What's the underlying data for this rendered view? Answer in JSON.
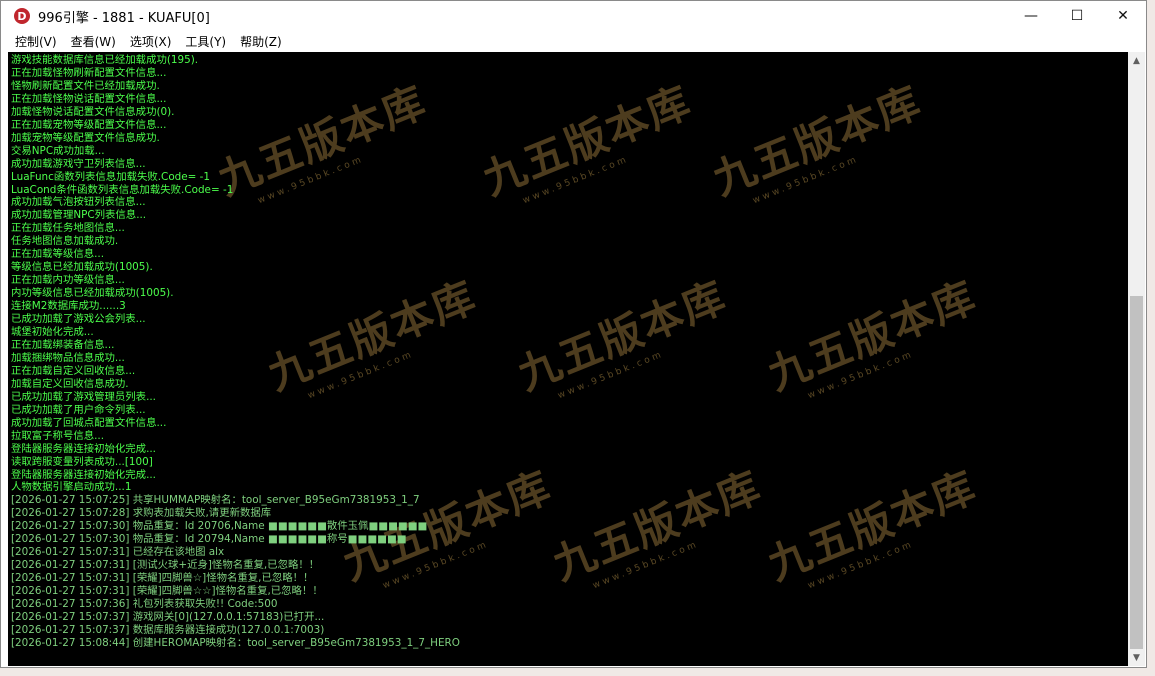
{
  "window": {
    "title": "996引擎 - 1881 - KUAFU[0]",
    "icon_letter": "D",
    "controls": {
      "minimize": "—",
      "maximize": "☐",
      "close": "✕"
    }
  },
  "menu": [
    "控制(V)",
    "查看(W)",
    "选项(X)",
    "工具(Y)",
    "帮助(Z)"
  ],
  "watermark": {
    "text": "九五版本库",
    "sub": "www.95bbk.com"
  },
  "log": [
    "游戏技能数据库信息已经加载成功(195).",
    "正在加载怪物刷新配置文件信息...",
    "怪物刷新配置文件已经加载成功.",
    "正在加载怪物说话配置文件信息...",
    "加载怪物说话配置文件信息成功(0).",
    "正在加载宠物等级配置文件信息...",
    "加载宠物等级配置文件信息成功.",
    "交易NPC成功加载...",
    "成功加载游戏守卫列表信息...",
    "LuaFunc函数列表信息加载失败.Code= -1",
    "LuaCond条件函数列表信息加载失败.Code= -1",
    "成功加载气泡按钮列表信息...",
    "成功加载管理NPC列表信息...",
    "正在加载任务地图信息...",
    "任务地图信息加载成功.",
    "正在加载等级信息...",
    "等级信息已经加载成功(1005).",
    "正在加载内功等级信息...",
    "内功等级信息已经加载成功(1005).",
    "连接M2数据库成功......3",
    "已成功加载了游戏公会列表...",
    "城堡初始化完成...",
    "正在加载绑装备信息...",
    "加载捆绑物品信息成功...",
    "正在加载自定义回收信息...",
    "加载自定义回收信息成功.",
    "已成功加载了游戏管理员列表...",
    "已成功加载了用户命令列表...",
    "成功加载了回城点配置文件信息...",
    "拉取富子称号信息...",
    "登陆器服务器连接初始化完成...",
    "读取跨服变量列表成功...[100]",
    "登陆器服务器连接初始化完成...",
    "人物数据引擎启动成功...1",
    "[2026-01-27 15:07:25] 共享HUMMAP映射名：tool_server_B95eGm7381953_1_7",
    "[2026-01-27 15:07:28] 求购表加载失败,请更新数据库",
    "[2026-01-27 15:07:30] 物品重复：Id 20706,Name ■■■■■■散件玉佩■■■■■■",
    "[2026-01-27 15:07:30] 物品重复：Id 20794,Name ■■■■■■称号■■■■■■",
    "[2026-01-27 15:07:31] 已经存在该地图 alx",
    "[2026-01-27 15:07:31] [测试火球+近身]怪物名重复,已忽略！！",
    "[2026-01-27 15:07:31] [荣耀]四脚兽☆]怪物名重复,已忽略！！",
    "[2026-01-27 15:07:31] [荣耀]四脚兽☆☆]怪物名重复,已忽略！！",
    "[2026-01-27 15:07:36] 礼包列表获取失败!! Code:500",
    "[2026-01-27 15:07:37] 游戏网关[0](127.0.0.1:57183)已打开...",
    "[2026-01-27 15:07:37] 数据库服务器连接成功(127.0.0.1:7003)",
    "[2026-01-27 15:08:44] 创建HEROMAP映射名：tool_server_B95eGm7381953_1_7_HERO"
  ],
  "scrollbar": {
    "up_arrow": "▲",
    "down_arrow": "▼"
  }
}
